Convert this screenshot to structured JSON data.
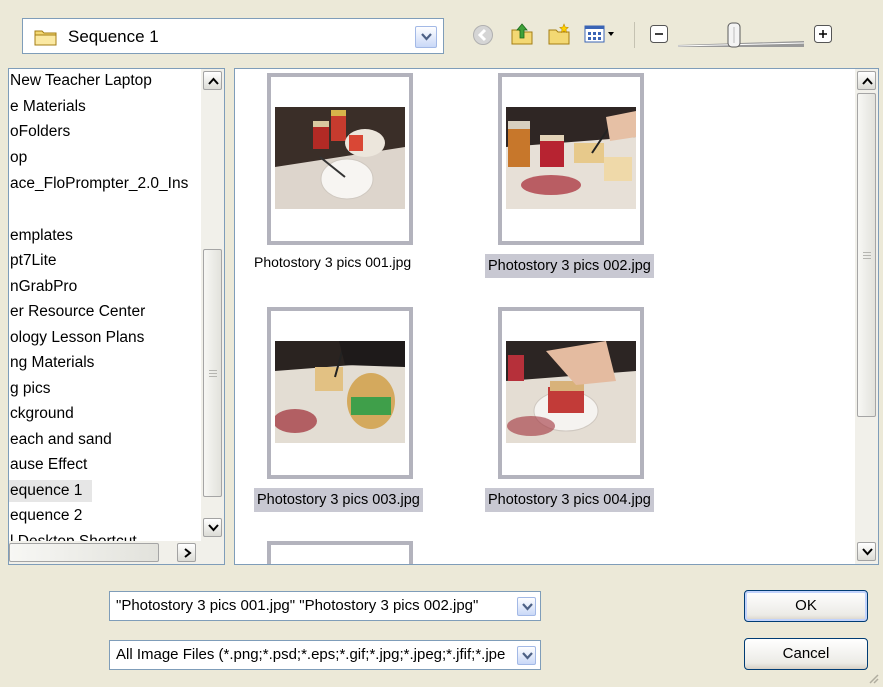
{
  "location": {
    "folder": "Sequence 1"
  },
  "toolbar": {
    "back_icon": "back-arrow-icon",
    "up_icon": "up-folder-icon",
    "new_folder_icon": "new-folder-icon",
    "views_icon": "views-menu-icon",
    "zoom_out_icon": "minus-icon",
    "zoom_in_icon": "plus-icon"
  },
  "tree": {
    "items": [
      "New Teacher Laptop",
      "e Materials",
      "oFolders",
      "op",
      "ace_FloPrompter_2.0_Ins",
      "",
      "emplates",
      "pt7Lite",
      "nGrabPro",
      "er Resource Center",
      "ology Lesson Plans",
      "ng Materials",
      "g pics",
      "ckground",
      "each and sand",
      "ause Effect",
      "equence 1",
      "equence 2",
      "l Desktop Shortcut"
    ],
    "selected_index": 16
  },
  "files": [
    {
      "name": "Photostory 3 pics 001.jpg"
    },
    {
      "name": "Photostory 3 pics 002.jpg"
    },
    {
      "name": "Photostory 3 pics 003.jpg"
    },
    {
      "name": "Photostory 3 pics 004.jpg"
    }
  ],
  "filename_field": {
    "value": "\"Photostory 3 pics 001.jpg\" \"Photostory 3 pics 002.jpg\""
  },
  "filetype_field": {
    "value": "All Image Files (*.png;*.psd;*.eps;*.gif;*.jpg;*.jpeg;*.jfif;*.jpe"
  },
  "buttons": {
    "ok": "OK",
    "cancel": "Cancel"
  },
  "colors": {
    "background": "#ece9d8",
    "selection": "#c8c8d2",
    "border": "#7f9db9"
  }
}
